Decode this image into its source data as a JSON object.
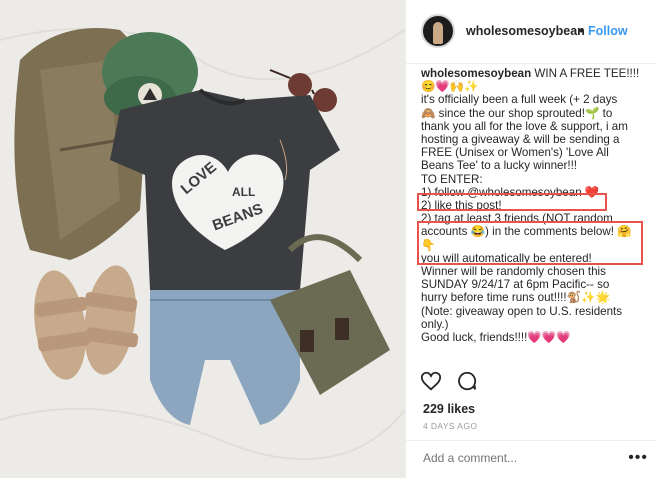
{
  "post": {
    "username": "wholesomesoybean",
    "separator": "•",
    "follow_label": "Follow"
  },
  "caption": {
    "username": "wholesomesoybean",
    "lines": [
      " WIN A FREE TEE!!!!",
      "😊💗🙌✨",
      "it's officially been a full week (+ 2 days",
      "🙈 since the our shop sprouted!🌱 to",
      "thank you all for the love & support, i am",
      "hosting a giveaway & will be sending a",
      "FREE (Unisex or Women's) 'Love All",
      "Beans Tee' to a lucky winner!!!",
      "TO ENTER:",
      "1) follow @wholesomesoybean ❤️",
      "2) like this post!",
      "2) tag at least 3 friends (NOT random",
      "accounts 😂) in the comments below! 🤗",
      "👇",
      "you will automatically be entered!",
      "Winner will be randomly chosen this",
      "SUNDAY 9/24/17 at 6pm Pacific-- so",
      "hurry before time runs out!!!!🐒✨🌟",
      "(Note: giveaway open to U.S. residents",
      "only.)",
      "Good luck, friends!!!!💗💗💗"
    ]
  },
  "photo": {
    "shirt_text_top": "LOVE",
    "shirt_text_mid": "ALL",
    "shirt_text_bottom": "BEANS"
  },
  "likes": "229 likes",
  "timestamp": "4 DAYS AGO",
  "comment": {
    "placeholder": "Add a comment...",
    "more": "•••"
  },
  "colors": {
    "link": "#3897f0",
    "highlight": "#e8534f",
    "muted": "#999999"
  }
}
